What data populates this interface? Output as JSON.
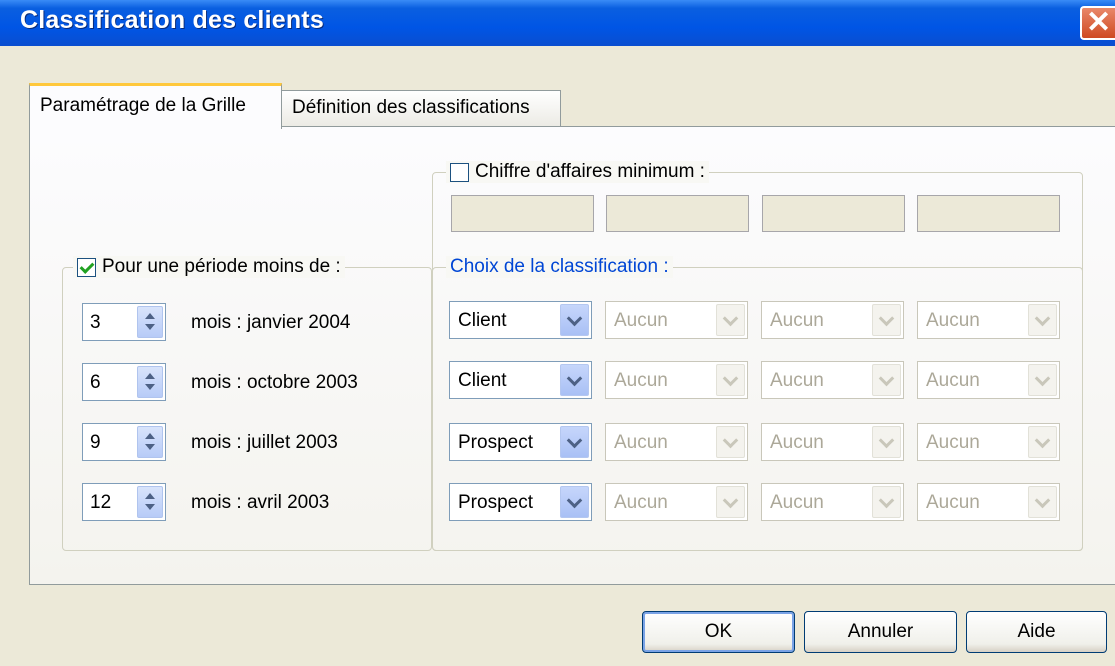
{
  "window": {
    "title": "Classification des clients",
    "close_glyph": "✕"
  },
  "tabs": [
    {
      "label": "Paramétrage de la Grille",
      "active": true
    },
    {
      "label": "Définition des classifications",
      "active": false
    }
  ],
  "period_group": {
    "label": "Pour une période moins de :",
    "checked": true,
    "rows": [
      {
        "value": "3",
        "text": "mois : janvier 2004"
      },
      {
        "value": "6",
        "text": "mois : octobre 2003"
      },
      {
        "value": "9",
        "text": "mois : juillet 2003"
      },
      {
        "value": "12",
        "text": "mois : avril 2003"
      }
    ]
  },
  "revenue_group": {
    "label": "Chiffre d'affaires minimum :",
    "checked": false
  },
  "classification_group": {
    "label": "Choix de la classification :",
    "label_color": "#0046d5",
    "rows": [
      [
        "Client",
        "Aucun",
        "Aucun",
        "Aucun"
      ],
      [
        "Client",
        "Aucun",
        "Aucun",
        "Aucun"
      ],
      [
        "Prospect",
        "Aucun",
        "Aucun",
        "Aucun"
      ],
      [
        "Prospect",
        "Aucun",
        "Aucun",
        "Aucun"
      ]
    ]
  },
  "buttons": {
    "ok": "OK",
    "cancel": "Annuler",
    "help": "Aide"
  }
}
